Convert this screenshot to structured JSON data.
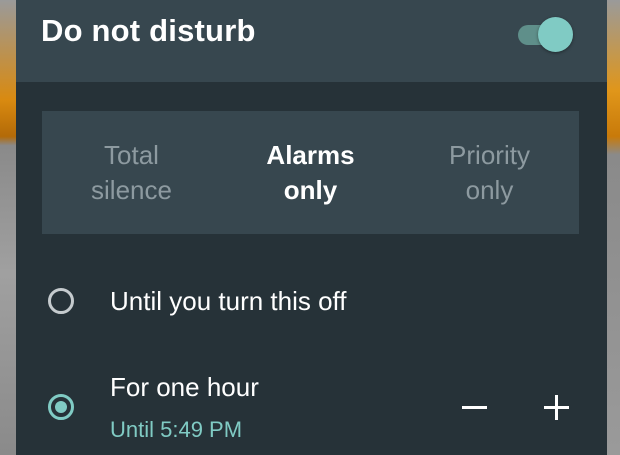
{
  "header": {
    "title": "Do not disturb",
    "toggle_on": true
  },
  "modes": [
    {
      "label": "Total\nsilence",
      "selected": false
    },
    {
      "label": "Alarms\nonly",
      "selected": true
    },
    {
      "label": "Priority\nonly",
      "selected": false
    }
  ],
  "options": [
    {
      "label": "Until you turn this off",
      "checked": false
    },
    {
      "label": "For one hour",
      "sublabel": "Until 5:49 PM",
      "checked": true
    }
  ],
  "colors": {
    "panel": "#263238",
    "header": "#37474f",
    "accent": "#80cbc4",
    "inactive_text": "#8d9aa0",
    "background_accent": "#d98a10"
  },
  "icons": {
    "decrease": "minus-icon",
    "increase": "plus-icon"
  }
}
